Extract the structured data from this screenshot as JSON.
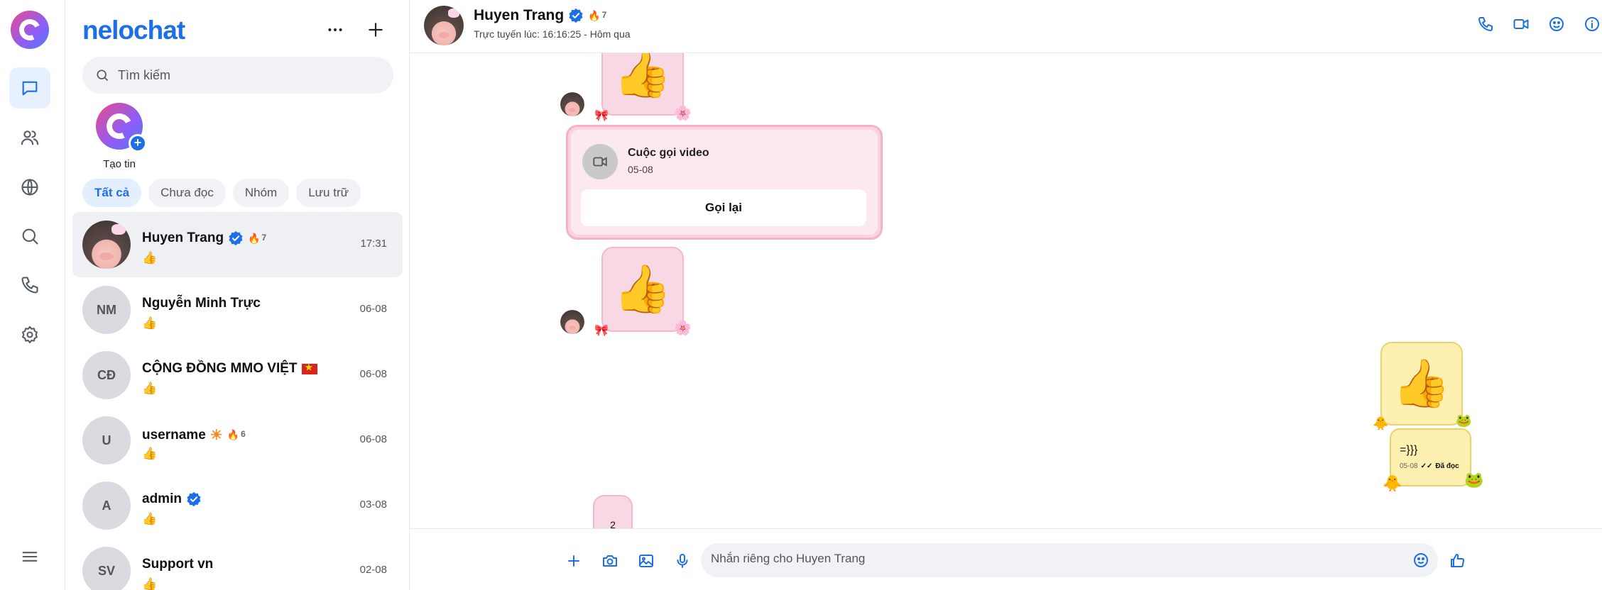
{
  "brand": "nelochat",
  "search": {
    "placeholder": "Tìm kiếm"
  },
  "story": {
    "label": "Tạo tin"
  },
  "filters": [
    "Tất cả",
    "Chưa đọc",
    "Nhóm",
    "Lưu trữ"
  ],
  "conversations": [
    {
      "name": "Huyen Trang",
      "initials": "",
      "preview": "👍",
      "time": "17:31",
      "verified": true,
      "streak": "7",
      "active": true
    },
    {
      "name": "Nguyễn Minh Trực",
      "initials": "NM",
      "preview": "👍",
      "time": "06-08"
    },
    {
      "name": "CỘNG ĐỒNG MMO VIỆT",
      "initials": "CĐ",
      "preview": "👍",
      "time": "06-08",
      "flag": "vietnam-flag"
    },
    {
      "name": "username",
      "initials": "U",
      "preview": "👍",
      "time": "06-08",
      "streak": "6",
      "badge": "sun-badge"
    },
    {
      "name": "admin",
      "initials": "A",
      "preview": "👍",
      "time": "03-08",
      "verified": true
    },
    {
      "name": "Support vn",
      "initials": "SV",
      "preview": "👍",
      "time": "02-08"
    }
  ],
  "chat": {
    "title": "Huyen Trang",
    "streak": "7",
    "status": "Trực tuyến lúc: 16:16:25 - Hôm qua",
    "call_card": {
      "title": "Cuộc gọi video",
      "date": "05-08",
      "button": "Gọi lại"
    },
    "outgoing_text": "=}}}",
    "outgoing_meta": {
      "date": "05-08",
      "read": "Đã đọc"
    },
    "sticker_emoji": "👍",
    "partial_sticker_text": "2"
  },
  "composer": {
    "placeholder": "Nhắn riêng cho Huyen Trang"
  },
  "colors": {
    "accent": "#1b6fe8",
    "pink_bubble": "#f8d8e4",
    "yellow_bubble": "#fdf0b0"
  }
}
